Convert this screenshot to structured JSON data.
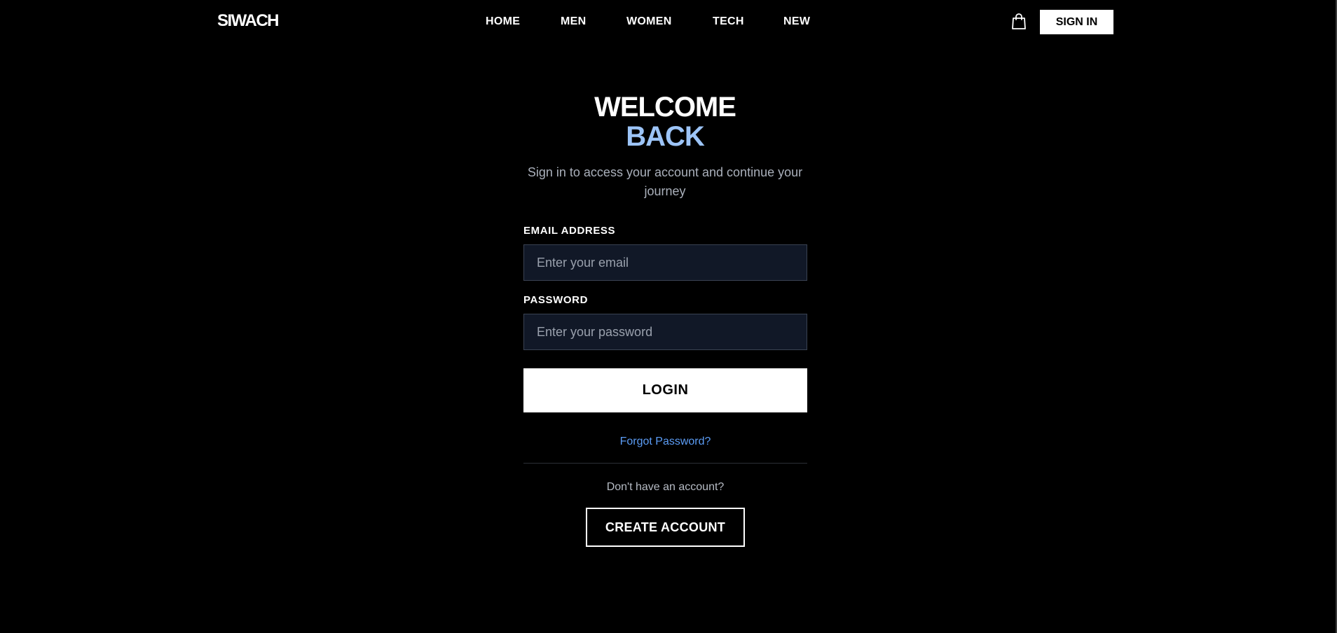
{
  "header": {
    "logo": "SIWACH",
    "nav": [
      {
        "label": "HOME"
      },
      {
        "label": "MEN"
      },
      {
        "label": "WOMEN"
      },
      {
        "label": "TECH"
      },
      {
        "label": "NEW"
      }
    ],
    "cart_icon": "shopping-bag-icon",
    "signin_label": "SIGN IN"
  },
  "login": {
    "title_line1": "WELCOME",
    "title_line2": "BACK",
    "subtitle": "Sign in to access your account and continue your journey",
    "email_label": "EMAIL ADDRESS",
    "email_placeholder": "Enter your email",
    "email_value": "",
    "password_label": "PASSWORD",
    "password_placeholder": "Enter your password",
    "password_value": "",
    "login_label": "LOGIN",
    "forgot_label": "Forgot Password?",
    "no_account_text": "Don't have an account?",
    "create_account_label": "CREATE ACCOUNT"
  },
  "colors": {
    "background": "#000000",
    "accent": "#9cc4f7",
    "link": "#5b9cf5",
    "input_bg": "#111827"
  }
}
